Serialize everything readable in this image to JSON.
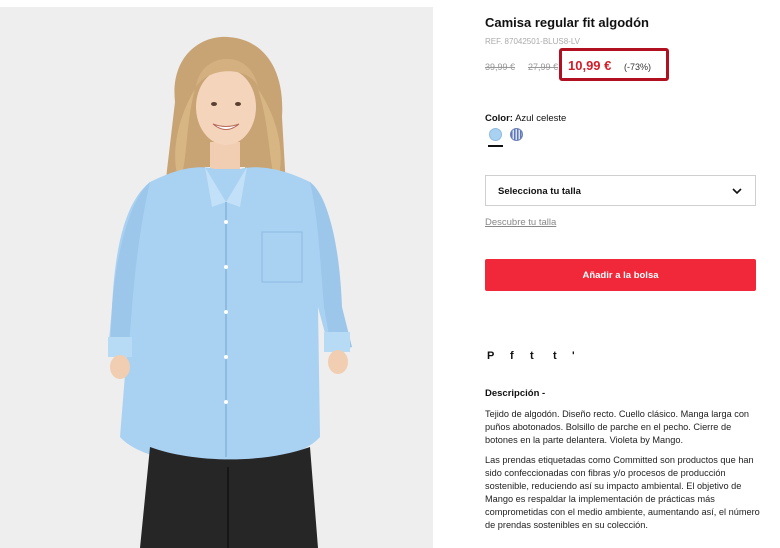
{
  "product": {
    "title": "Camisa regular fit algodón",
    "ref": "REF. 87042501-BLUS8-LV",
    "old_price_1": "39,99 €",
    "old_price_2": "27,99 €",
    "sale_price": "10,99 €",
    "discount": "(-73%)"
  },
  "color": {
    "label": "Color:",
    "value": " Azul celeste",
    "swatches": [
      "azul-celeste",
      "rayas-azul"
    ]
  },
  "size": {
    "placeholder": "Selecciona tu talla",
    "guide_link": "Descubre tu talla"
  },
  "actions": {
    "add_to_bag": "Añadir a la bolsa"
  },
  "share": {
    "pinterest": "P",
    "facebook": "f",
    "twitter": "t",
    "tumblr": "t",
    "more": "'"
  },
  "description": {
    "title": "Descripción -",
    "paragraph_1": "Tejido de algodón. Diseño recto. Cuello clásico. Manga larga con puños abotonados. Bolsillo de parche en el pecho. Cierre de botones en la parte delantera. Violeta by Mango.",
    "paragraph_2": "Las prendas etiquetadas como Committed son productos que han sido confeccionadas con fibras y/o procesos de producción sostenible, reduciendo así su impacto ambiental. El objetivo de Mango es respaldar la implementación de prácticas más comprometidas con el medio ambiente, aumentando así, el número de prendas sostenibles en su colección."
  },
  "colors": {
    "sale_red": "#d31d2a",
    "button_red": "#f0283a",
    "highlight_border": "#b01020",
    "shirt_blue": "#a9d1f2"
  }
}
